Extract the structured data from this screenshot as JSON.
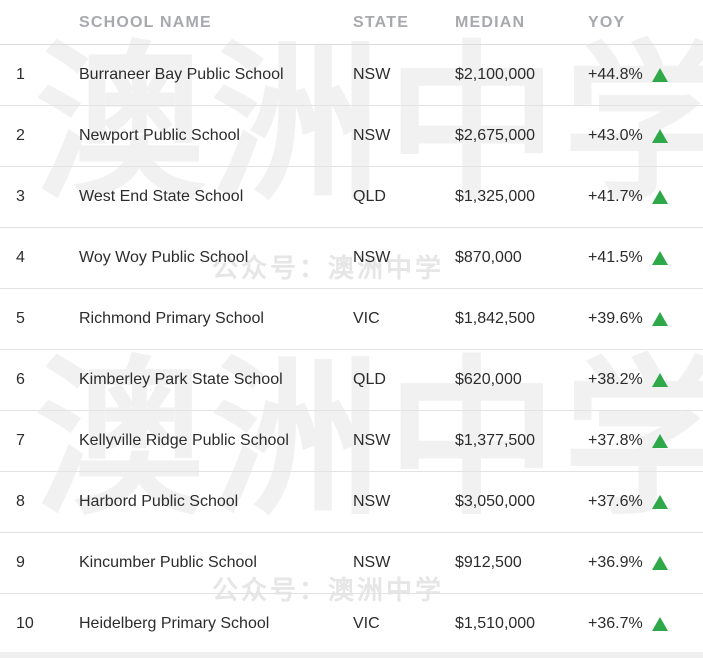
{
  "header": {
    "rank": "",
    "school": "SCHOOL NAME",
    "state": "STATE",
    "median": "MEDIAN",
    "yoy": "YOY"
  },
  "colors": {
    "up_arrow": "#2fa84a",
    "header_text": "#a7a9ad"
  },
  "rows": [
    {
      "rank": "1",
      "school": "Burraneer Bay Public School",
      "state": "NSW",
      "median": "$2,100,000",
      "yoy": "+44.8%"
    },
    {
      "rank": "2",
      "school": "Newport Public School",
      "state": "NSW",
      "median": "$2,675,000",
      "yoy": "+43.0%"
    },
    {
      "rank": "3",
      "school": "West End State School",
      "state": "QLD",
      "median": "$1,325,000",
      "yoy": "+41.7%"
    },
    {
      "rank": "4",
      "school": "Woy Woy Public School",
      "state": "NSW",
      "median": "$870,000",
      "yoy": "+41.5%"
    },
    {
      "rank": "5",
      "school": "Richmond Primary School",
      "state": "VIC",
      "median": "$1,842,500",
      "yoy": "+39.6%"
    },
    {
      "rank": "6",
      "school": "Kimberley Park State School",
      "state": "QLD",
      "median": "$620,000",
      "yoy": "+38.2%"
    },
    {
      "rank": "7",
      "school": "Kellyville Ridge Public School",
      "state": "NSW",
      "median": "$1,377,500",
      "yoy": "+37.8%"
    },
    {
      "rank": "8",
      "school": "Harbord Public School",
      "state": "NSW",
      "median": "$3,050,000",
      "yoy": "+37.6%"
    },
    {
      "rank": "9",
      "school": "Kincumber Public School",
      "state": "NSW",
      "median": "$912,500",
      "yoy": "+36.9%"
    },
    {
      "rank": "10",
      "school": "Heidelberg Primary School",
      "state": "VIC",
      "median": "$1,510,000",
      "yoy": "+36.7%"
    }
  ],
  "watermark": {
    "big": "澳洲中学",
    "small": "公众号：澳洲中学"
  }
}
